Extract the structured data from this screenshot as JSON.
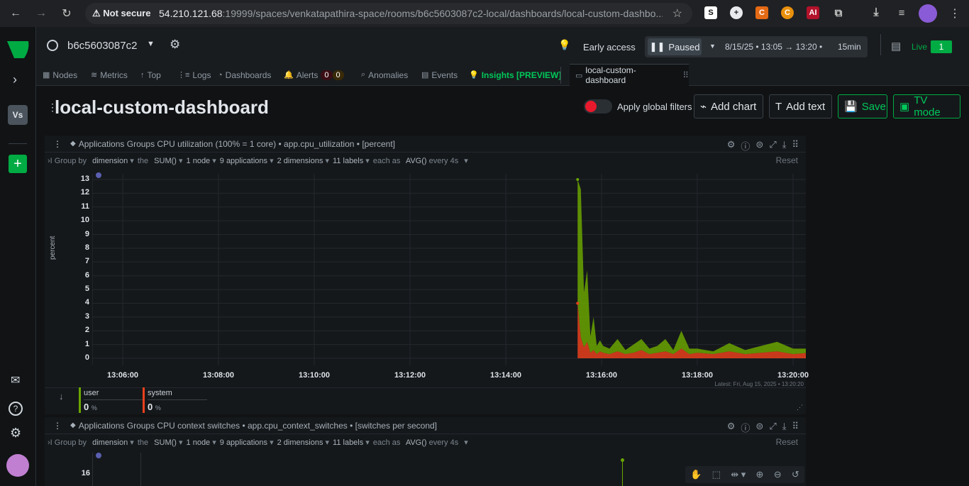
{
  "browser": {
    "not_secure": "Not secure",
    "url_host": "54.210.121.68",
    "url_rest": ":19999/spaces/venkatapathira-space/rooms/b6c5603087c2-local/dashboards/local-custom-dashbo..."
  },
  "rail": {
    "space_initials": "Vs"
  },
  "topbar": {
    "node_name": "b6c5603087c2",
    "early_access": "Early access",
    "paused": "Paused",
    "time_range": "8/15/25 • 13:05 → 13:20 •",
    "duration": "15min",
    "live": "Live",
    "live_count": "1"
  },
  "tabs": [
    {
      "label": "Nodes"
    },
    {
      "label": "Metrics"
    },
    {
      "label": "Top"
    },
    {
      "label": "Logs"
    },
    {
      "label": "Dashboards"
    },
    {
      "label": "Alerts",
      "badge_critical": "0",
      "badge_warning": "0"
    },
    {
      "label": "Anomalies"
    },
    {
      "label": "Events"
    },
    {
      "label": "Insights [PREVIEW]"
    },
    {
      "label": "local-custom-dashboard"
    }
  ],
  "dashboard": {
    "title": "local-custom-dashboard",
    "apply_filters": "Apply global filters",
    "add_chart": "Add chart",
    "add_text": "Add text",
    "save": "Save",
    "tv_mode": "TV mode"
  },
  "filters": {
    "group_by": "Group by",
    "dimension": "dimension",
    "the": "the",
    "sum": "SUM()",
    "nodes": "1 node",
    "applications": "9 applications",
    "dimensions": "2 dimensions",
    "labels": "11 labels",
    "each_as": "each as",
    "avg": "AVG()",
    "every": "every 4s",
    "reset": "Reset"
  },
  "panel1": {
    "title": "Applications Groups CPU utilization (100% = 1 core) • app.cpu_utilization • [percent]",
    "ylabel": "percent",
    "latest": "Latest: Fri, Aug 15, 2025 • 13:20:20",
    "legend": [
      {
        "name": "user",
        "value": "0",
        "unit": "%",
        "color": "#6aa500"
      },
      {
        "name": "system",
        "value": "0",
        "unit": "%",
        "color": "#e8401c"
      }
    ]
  },
  "panel2": {
    "title": "Applications Groups CPU context switches • app.cpu_context_switches • [switches per second]",
    "first_tick": "16"
  },
  "chart_data": {
    "type": "area",
    "title": "Applications Groups CPU utilization (100% = 1 core)",
    "ylabel": "percent",
    "ylim": [
      0,
      13
    ],
    "y_ticks": [
      "0",
      "1",
      "2",
      "3",
      "4",
      "5",
      "6",
      "7",
      "8",
      "9",
      "10",
      "11",
      "12",
      "13"
    ],
    "x_ticks": [
      "13:06:00",
      "13:08:00",
      "13:10:00",
      "13:12:00",
      "13:14:00",
      "13:16:00",
      "13:18:00",
      "13:20:00"
    ],
    "x": [
      "13:15:30",
      "13:15:34",
      "13:15:38",
      "13:15:42",
      "13:15:46",
      "13:15:50",
      "13:15:54",
      "13:15:58",
      "13:16:02",
      "13:16:10",
      "13:16:20",
      "13:16:30",
      "13:16:40",
      "13:16:50",
      "13:17:00",
      "13:17:10",
      "13:17:20",
      "13:17:30",
      "13:17:40",
      "13:17:50",
      "13:18:00",
      "13:18:20",
      "13:18:40",
      "13:19:00",
      "13:19:20",
      "13:19:40",
      "13:20:00",
      "13:20:20"
    ],
    "series": [
      {
        "name": "system",
        "color": "#e8401c",
        "values": [
          4.0,
          1.5,
          0.8,
          1.2,
          0.4,
          0.6,
          0.3,
          0.5,
          0.4,
          0.3,
          0.5,
          0.3,
          0.4,
          0.6,
          0.3,
          0.4,
          0.5,
          0.3,
          0.7,
          0.3,
          0.4,
          0.3,
          0.5,
          0.3,
          0.4,
          0.5,
          0.3,
          0.4
        ]
      },
      {
        "name": "user",
        "color": "#6aa500",
        "values": [
          9.0,
          10.8,
          4.0,
          5.2,
          1.2,
          2.4,
          0.6,
          0.8,
          0.5,
          0.4,
          0.9,
          0.3,
          0.6,
          0.8,
          0.4,
          0.5,
          0.9,
          0.3,
          1.3,
          0.4,
          0.3,
          0.2,
          0.6,
          0.3,
          0.5,
          0.7,
          0.4,
          0.3
        ]
      }
    ]
  }
}
